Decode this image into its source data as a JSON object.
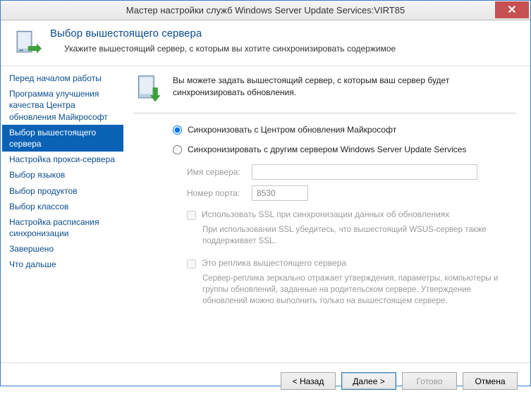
{
  "window": {
    "title": "Мастер настройки служб Windows Server Update Services:VIRT85"
  },
  "header": {
    "title": "Выбор вышестоящего сервера",
    "subtitle": "Укажите вышестоящий сервер, с которым вы хотите синхронизировать содержимое"
  },
  "sidebar": {
    "items": [
      {
        "label": "Перед началом работы",
        "selected": false
      },
      {
        "label": "Программа улучшения качества Центра обновления Майкрософт",
        "selected": false
      },
      {
        "label": "Выбор вышестоящего сервера",
        "selected": true
      },
      {
        "label": "Настройка прокси-сервера",
        "selected": false
      },
      {
        "label": "Выбор языков",
        "selected": false
      },
      {
        "label": "Выбор продуктов",
        "selected": false
      },
      {
        "label": "Выбор классов",
        "selected": false
      },
      {
        "label": "Настройка расписания синхронизации",
        "selected": false
      },
      {
        "label": "Завершено",
        "selected": false
      },
      {
        "label": "Что дальше",
        "selected": false
      }
    ]
  },
  "content": {
    "intro": "Вы можете задать вышестоящий сервер, с которым ваш сервер будет синхронизировать обновления.",
    "radio_ms": "Синхронизовать с Центром обновления Майкрософт",
    "radio_other": "Синхронизировать с другим сервером Windows Server Update Services",
    "selected_radio": "ms",
    "server_name_label": "Имя сервера:",
    "server_name_value": "",
    "port_label": "Номер порта:",
    "port_value": "8530",
    "ssl_label": "Использовать SSL при синхронизации данных об обновлениях",
    "ssl_help": "При использовании SSL убедитесь, что вышестоящий WSUS-сервер также поддерживает SSL.",
    "replica_label": "Это реплика вышестоящего сервера",
    "replica_help": "Сервер-реплика зеркально отражает утверждения, параметры, компьютеры и группы обновлений, заданные на родительском сервере. Утверждение обновлений можно выполнить только на вышестоящем сервере."
  },
  "buttons": {
    "back": "< Назад",
    "next": "Далее >",
    "finish": "Готово",
    "cancel": "Отмена"
  }
}
